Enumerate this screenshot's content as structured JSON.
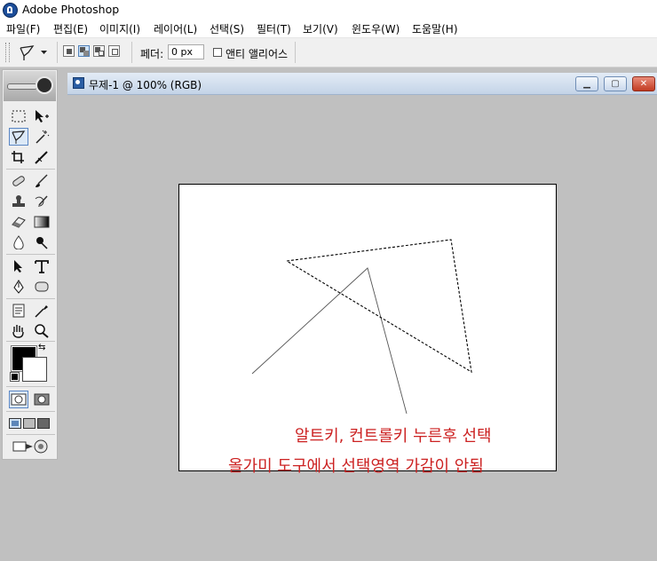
{
  "app": {
    "title": "Adobe Photoshop"
  },
  "menubar": {
    "items": [
      {
        "label": "파일(F)"
      },
      {
        "label": "편집(E)"
      },
      {
        "label": "이미지(I)"
      },
      {
        "label": "레이어(L)"
      },
      {
        "label": "선택(S)"
      },
      {
        "label": "필터(T)"
      },
      {
        "label": "보기(V)"
      },
      {
        "label": "윈도우(W)"
      },
      {
        "label": "도움말(H)"
      }
    ]
  },
  "options": {
    "tool_icon": "polygonal-lasso-icon",
    "selection_modes": [
      "new-selection",
      "add-to-selection",
      "subtract-from-selection",
      "intersect-selection"
    ],
    "active_mode": "add-to-selection",
    "feather_label": "페더:",
    "feather_value": "0 px",
    "antialias_label": "앤티 앨리어스",
    "antialias_checked": false
  },
  "document": {
    "title": "무제-1 @ 100% (RGB)",
    "canvas_color": "#ffffff"
  },
  "annotations": {
    "line1": "알트키, 컨트롤키 누른후 선택",
    "line2": "올가미 도구에서 선택영역 가감이 안됨",
    "color": "#cc2222"
  },
  "toolbox": {
    "tools": [
      "rectangular-marquee",
      "move",
      "polygonal-lasso",
      "magic-wand",
      "crop",
      "slice",
      "healing-brush",
      "brush",
      "clone-stamp",
      "history-brush",
      "eraser",
      "gradient",
      "blur",
      "dodge",
      "path-selection",
      "type",
      "pen",
      "shape",
      "notes",
      "eyedropper",
      "hand",
      "zoom"
    ],
    "active_tool": "polygonal-lasso",
    "foreground_color": "#000000",
    "background_color": "#ffffff"
  }
}
